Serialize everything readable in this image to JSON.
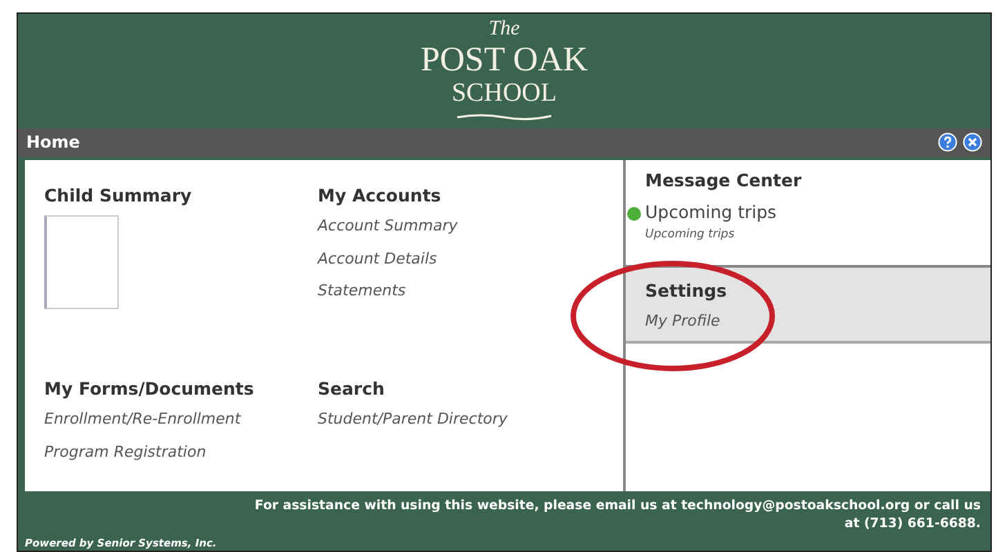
{
  "logo": {
    "line_1": "The",
    "line_2": "POST OAK",
    "line_3": "SCHOOL"
  },
  "title_bar": {
    "title": "Home",
    "buttons": [
      {
        "kind": "help"
      },
      {
        "kind": "close"
      }
    ]
  },
  "sections": [
    {
      "title": "Child Summary",
      "kind": "photo"
    },
    {
      "title": "My Accounts",
      "kind": "links",
      "links": [
        "Account Summary",
        "Account Details",
        "Statements"
      ]
    },
    {
      "title": "My Forms/Documents",
      "kind": "links",
      "links": [
        "Enrollment/Re-Enrollment",
        "Program Registration"
      ]
    },
    {
      "title": "Search",
      "kind": "links",
      "links": [
        "Student/Parent Directory"
      ]
    }
  ],
  "message_center": {
    "title": "Message Center",
    "messages": [
      {
        "title": "Upcoming trips",
        "subtitle": "Upcoming trips",
        "color": "#4caf3a"
      }
    ]
  },
  "settings": {
    "title": "Settings",
    "links": [
      "My Profile"
    ],
    "highlighted": true
  },
  "annotations": [
    {
      "kind": "ellipse"
    }
  ],
  "footer": {
    "assistance": "For assistance with using this website, please email us at technology@postoakschool.org or call us at (713) 661-6688.",
    "powered_by": "Powered by Senior Systems, Inc."
  }
}
